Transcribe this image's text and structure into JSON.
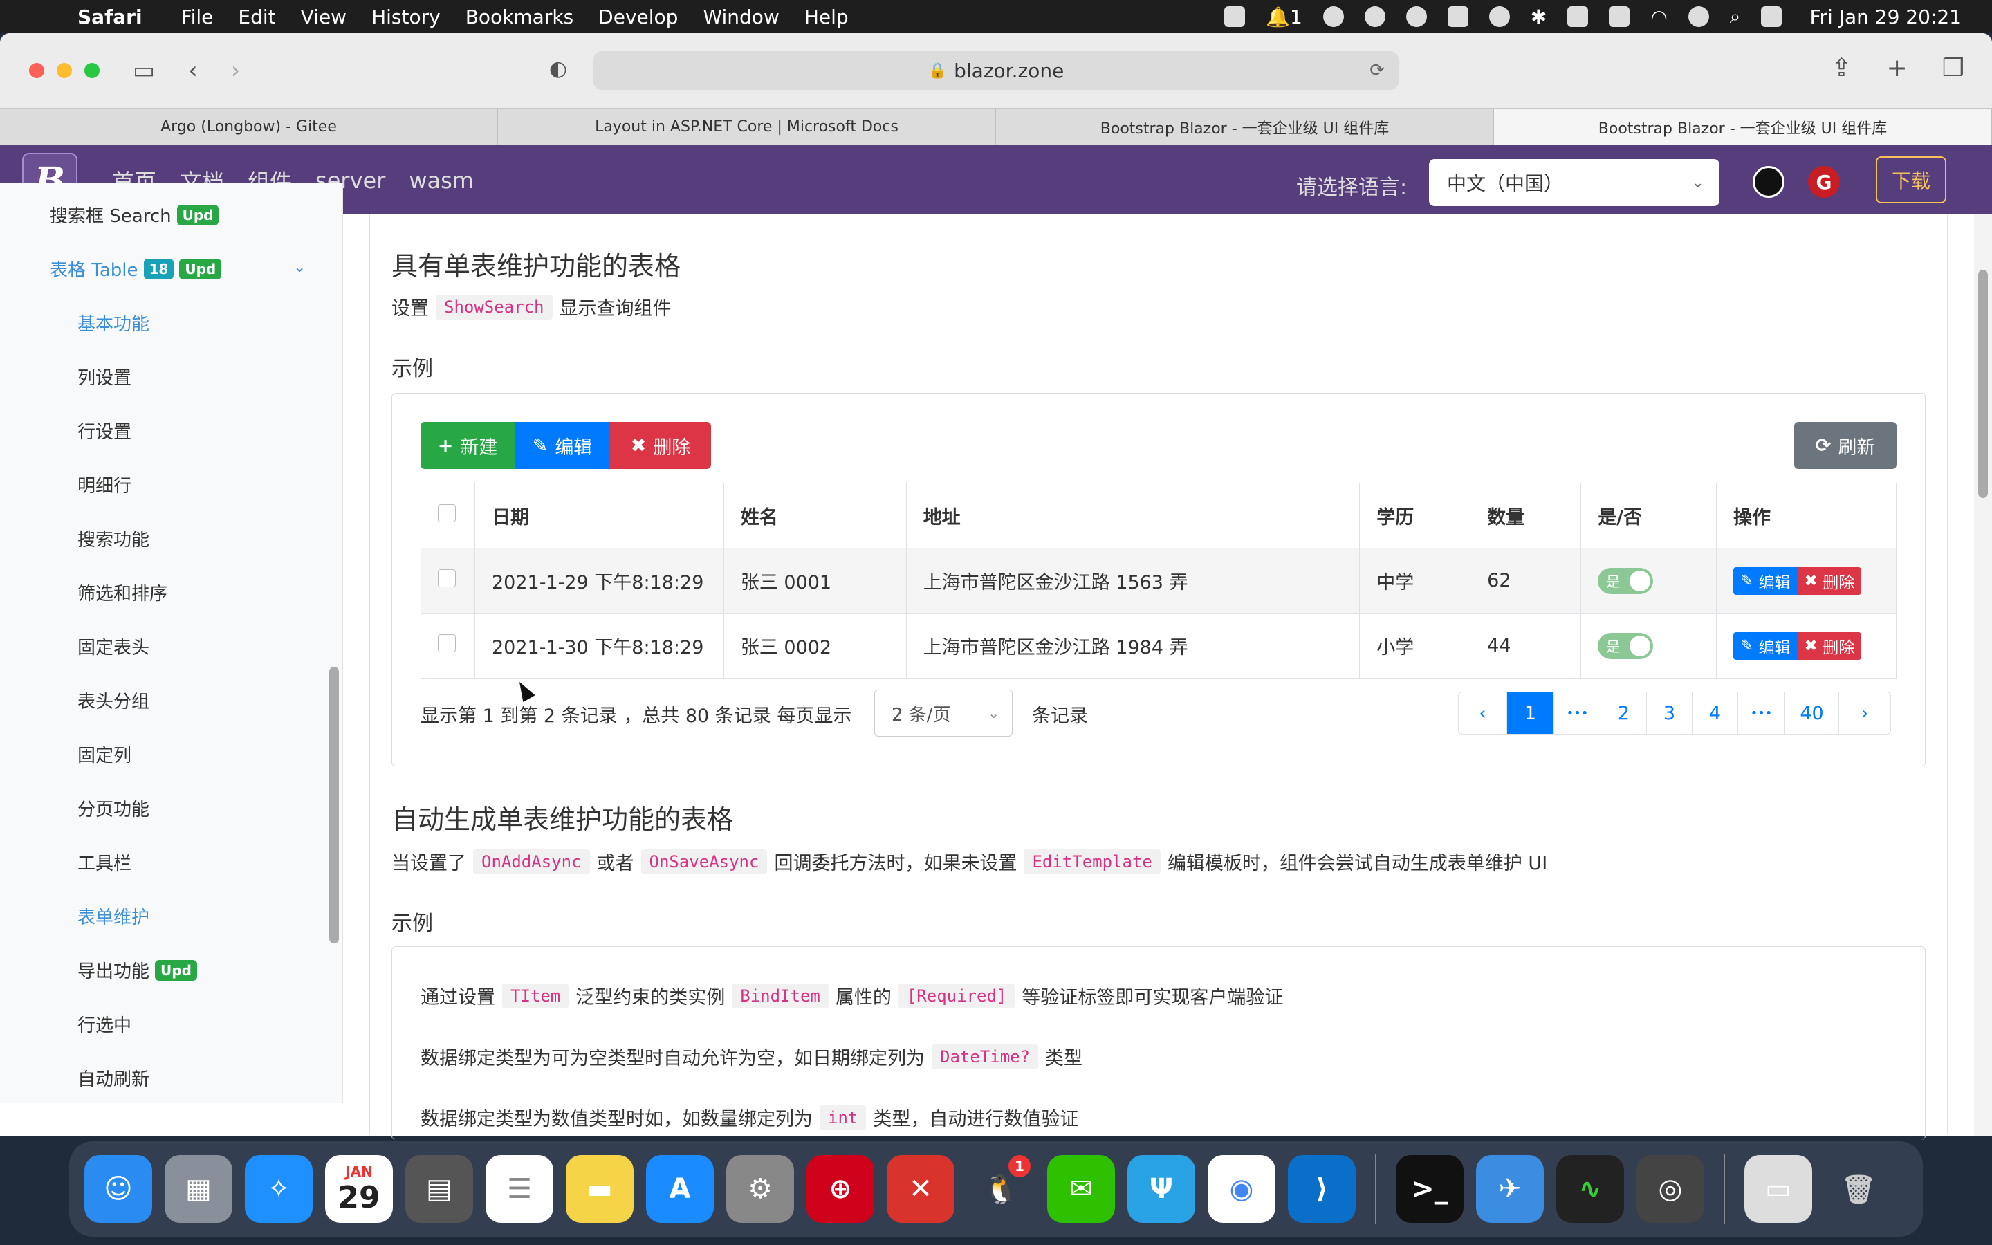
{
  "menubar": {
    "app_name": "Safari",
    "items": [
      "File",
      "Edit",
      "View",
      "History",
      "Bookmarks",
      "Develop",
      "Window",
      "Help"
    ],
    "clock": "Fri Jan 29  20:21",
    "notif_count": "1"
  },
  "browser": {
    "url": "blazor.zone",
    "tabs": [
      "Argo (Longbow) - Gitee",
      "Layout in ASP.NET Core | Microsoft Docs",
      "Bootstrap Blazor - 一套企业级 UI 组件库",
      "Bootstrap Blazor - 一套企业级 UI 组件库"
    ]
  },
  "navbar": {
    "logo": "B",
    "links": [
      "首页",
      "文档",
      "组件",
      "server",
      "wasm"
    ],
    "lang_label": "请选择语言:",
    "lang_value": "中文（中国）",
    "download": "下载",
    "gitee_letter": "G"
  },
  "sidebar": {
    "search": "搜索框 Search",
    "search_badge": "Upd",
    "table": "表格 Table",
    "table_count": "18",
    "table_badge": "Upd",
    "items": [
      "基本功能",
      "列设置",
      "行设置",
      "明细行",
      "搜索功能",
      "筛选和排序",
      "固定表头",
      "表头分组",
      "固定列",
      "分页功能",
      "工具栏",
      "表单维护",
      "导出功能",
      "行选中",
      "自动刷新"
    ],
    "export_badge": "Upd"
  },
  "section1": {
    "title": "具有单表维护功能的表格",
    "desc_pre": "设置",
    "desc_code": "ShowSearch",
    "desc_post": "显示查询组件",
    "example": "示例"
  },
  "toolbar": {
    "add": "新建",
    "edit": "编辑",
    "delete": "删除",
    "refresh": "刷新"
  },
  "table": {
    "headers": [
      "日期",
      "姓名",
      "地址",
      "学历",
      "数量",
      "是/否",
      "操作"
    ],
    "rows": [
      {
        "date": "2021-1-29 下午8:18:29",
        "name": "张三 0001",
        "address": "上海市普陀区金沙江路 1563 弄",
        "edu": "中学",
        "count": "62",
        "flag": "是",
        "edit": "编辑",
        "del": "删除"
      },
      {
        "date": "2021-1-30 下午8:18:29",
        "name": "张三 0002",
        "address": "上海市普陀区金沙江路 1984 弄",
        "edu": "小学",
        "count": "44",
        "flag": "是",
        "edit": "编辑",
        "del": "删除"
      }
    ]
  },
  "pager": {
    "summary": "显示第 1 到第 2 条记录 ，总共 80 条记录 每页显示",
    "page_size": "2 条/页",
    "suffix": "条记录",
    "pages": [
      "‹",
      "1",
      "•••",
      "2",
      "3",
      "4",
      "•••",
      "40",
      "›"
    ]
  },
  "section2": {
    "title": "自动生成单表维护功能的表格",
    "desc1": "当设置了",
    "code1": "OnAddAsync",
    "desc2": "或者",
    "code2": "OnSaveAsync",
    "desc3": "回调委托方法时，如果未设置",
    "code3": "EditTemplate",
    "desc4": "编辑模板时，组件会尝试自动生成表单维护 UI",
    "example": "示例",
    "line1_a": "通过设置",
    "line1_code1": "TItem",
    "line1_b": "泛型约束的类实例",
    "line1_code2": "BindItem",
    "line1_c": "属性的",
    "line1_code3": "[Required]",
    "line1_d": "等验证标签即可实现客户端验证",
    "line2_a": "数据绑定类型为可为空类型时自动允许为空，如日期绑定列为",
    "line2_code": "DateTime?",
    "line2_b": "类型",
    "line3_a": "数据绑定类型为数值类型时如，如数量绑定列为",
    "line3_code": "int",
    "line3_b": "类型，自动进行数值验证"
  },
  "dock": {
    "calendar_month": "JAN",
    "calendar_day": "29",
    "qq_badge": "1"
  }
}
